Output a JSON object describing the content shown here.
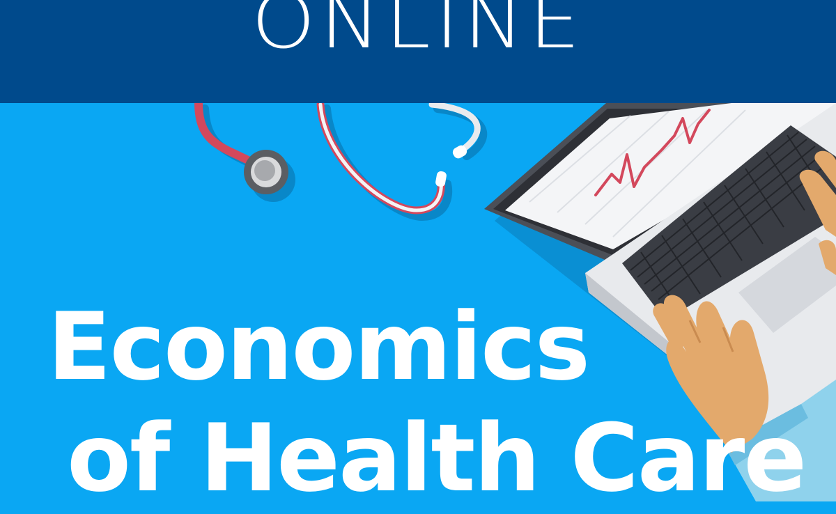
{
  "banner": {
    "label": "ONLINE"
  },
  "headline": {
    "line1": "Economics",
    "line2": "of Health Care"
  },
  "illustration": {
    "icons": [
      "stethoscope-icon",
      "laptop-icon",
      "heartbeat-icon",
      "hands-icon"
    ]
  },
  "colors": {
    "background": "#0aa7f3",
    "banner": "#004a8c",
    "text": "#ffffff",
    "stethoscope_tube": "#d3485c",
    "heartbeat_line": "#d3485c",
    "skin": "#e3a96c"
  }
}
